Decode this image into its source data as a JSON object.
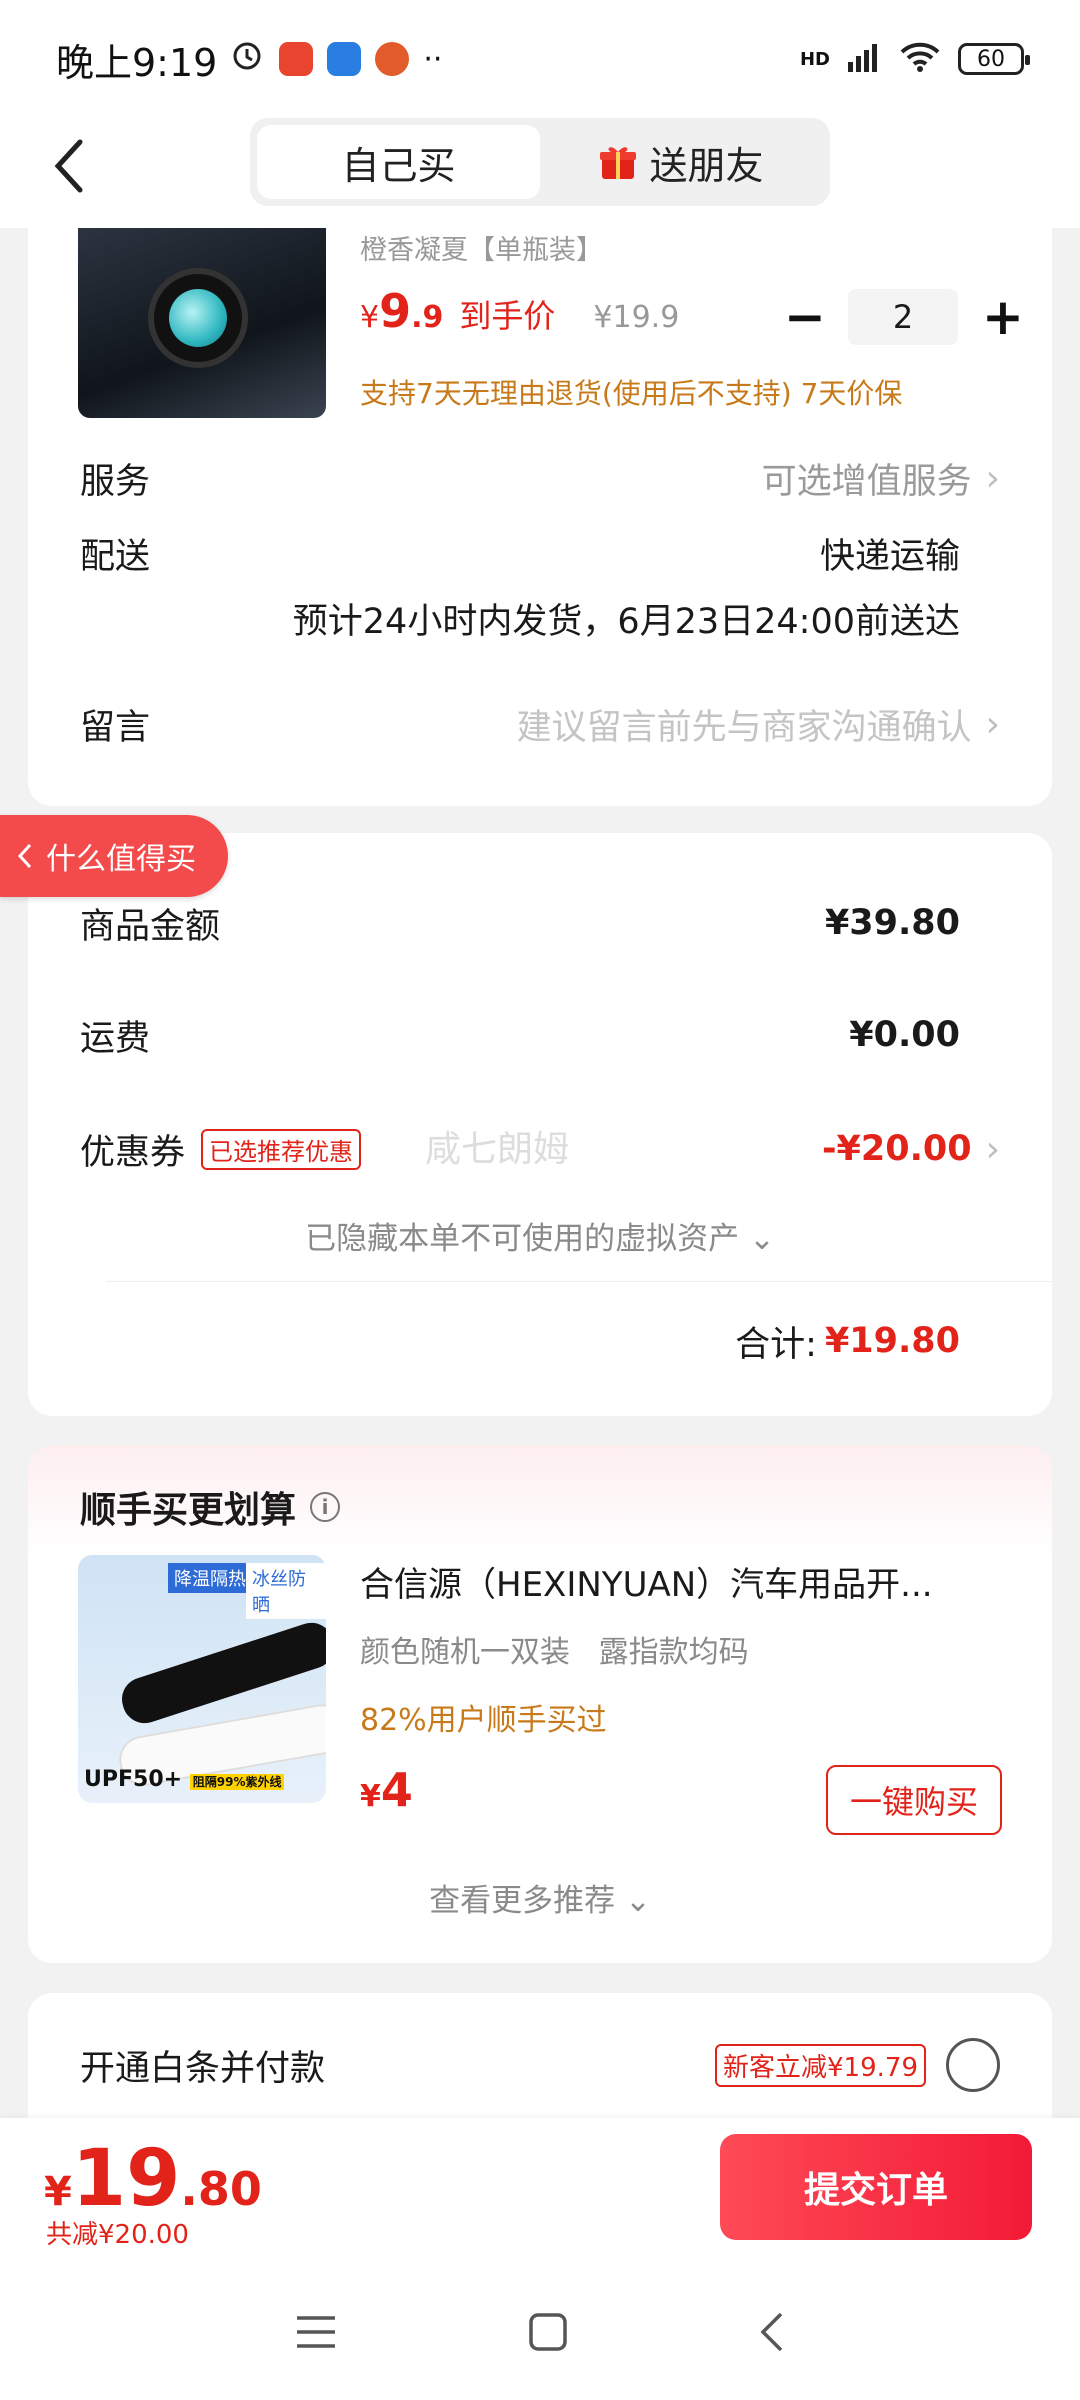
{
  "status": {
    "time": "晚上9:19",
    "network": "HD",
    "battery": "60"
  },
  "nav": {
    "tab_self": "自己买",
    "tab_gift": "送朋友"
  },
  "product": {
    "variant": "橙香凝夏【单瓶装】",
    "price_currency": "¥",
    "price_int": "9",
    "price_dec": ".9",
    "price_label": "到手价",
    "orig_price": "¥19.9",
    "qty": "2",
    "minus": "−",
    "plus": "+",
    "policy": "支持7天无理由退货(使用后不支持) 7天价保"
  },
  "service": {
    "label": "服务",
    "value": "可选增值服务"
  },
  "delivery": {
    "label": "配送",
    "method": "快递运输",
    "eta": "预计24小时内发货，6月23日24:00前送达"
  },
  "message": {
    "label": "留言",
    "placeholder": "建议留言前先与商家沟通确认"
  },
  "floating_tag": "什么值得买",
  "summary": {
    "goods_label": "商品金额",
    "goods_value": "¥39.80",
    "shipping_label": "运费",
    "shipping_value": "¥0.00",
    "coupon_label": "优惠券",
    "coupon_badge": "已选推荐优惠",
    "coupon_value": "-¥20.00",
    "hidden_assets": "已隐藏本单不可使用的虚拟资产",
    "total_label": "合计:",
    "total_value": "¥19.80",
    "watermark": "咸七朗姆"
  },
  "recommend": {
    "title": "顺手买更划算",
    "info": "i",
    "name": "合信源（HEXINYUAN）汽车用品开...",
    "spec": "颜色随机一双装   露指款均码",
    "stat": "82%用户顺手买过",
    "price_cur": "¥",
    "price": "4",
    "buy_label": "一键购买",
    "img_tag1": "降温隔热",
    "img_tag2": "冰丝防晒",
    "img_upf": "UPF50+",
    "img_upf_note": "阻隔99%紫外线",
    "more": "查看更多推荐"
  },
  "baitiao": {
    "label": "开通白条并付款",
    "badge": "新客立减¥19.79"
  },
  "bottom": {
    "cur": "¥",
    "int": "19",
    "dec": ".80",
    "saved": "共减¥20.00",
    "submit": "提交订单"
  }
}
